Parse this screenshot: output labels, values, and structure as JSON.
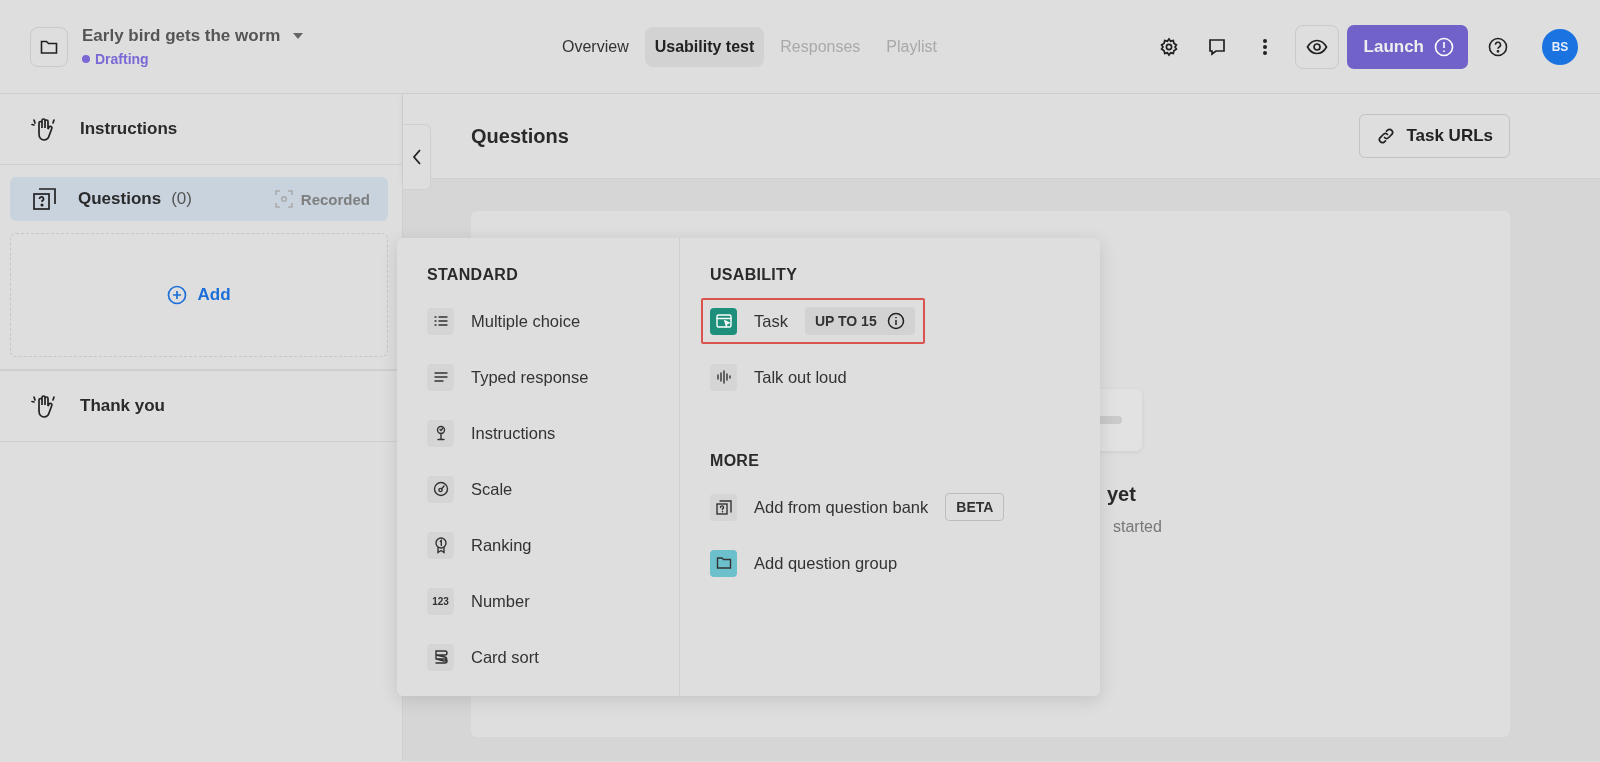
{
  "project": {
    "title": "Early bird gets the worm",
    "status": "Drafting"
  },
  "tabs": [
    {
      "label": "Overview",
      "selected": false,
      "disabled": false
    },
    {
      "label": "Usability test",
      "selected": true,
      "disabled": false
    },
    {
      "label": "Responses",
      "selected": false,
      "disabled": true
    },
    {
      "label": "Playlist",
      "selected": false,
      "disabled": true
    }
  ],
  "launch_button": "Launch",
  "avatar": "BS",
  "sidebar": {
    "items": [
      {
        "kind": "intro",
        "label": "Instructions",
        "selected": false
      },
      {
        "kind": "questions",
        "label": "Questions",
        "count": "(0)",
        "tag": "Recorded",
        "selected": true
      },
      {
        "kind": "add",
        "label": "Add"
      },
      {
        "kind": "outro",
        "label": "Thank you",
        "selected": false
      }
    ]
  },
  "main": {
    "title": "Questions",
    "task_urls_button": "Task URLs",
    "empty_state": {
      "title": "yet",
      "text": "started"
    }
  },
  "menu": {
    "sections": [
      {
        "heading": "STANDARD",
        "items": [
          {
            "label": "Multiple choice",
            "highlighted": false
          },
          {
            "label": "Typed response",
            "highlighted": false
          },
          {
            "label": "Instructions",
            "highlighted": false
          },
          {
            "label": "Scale",
            "highlighted": false
          },
          {
            "label": "Ranking",
            "highlighted": false
          },
          {
            "label": "Number",
            "icon_text": "123",
            "highlighted": false
          },
          {
            "label": "Card sort",
            "highlighted": false
          }
        ]
      },
      {
        "heading": "USABILITY",
        "items": [
          {
            "label": "Task",
            "badge": "UP TO 15",
            "highlighted": true
          },
          {
            "label": "Talk out loud",
            "highlighted": false
          }
        ]
      },
      {
        "heading": "MORE",
        "items": [
          {
            "label": "Add from question bank",
            "badge": "BETA",
            "highlighted": false
          },
          {
            "label": "Add question group",
            "highlighted": false
          }
        ]
      }
    ]
  }
}
